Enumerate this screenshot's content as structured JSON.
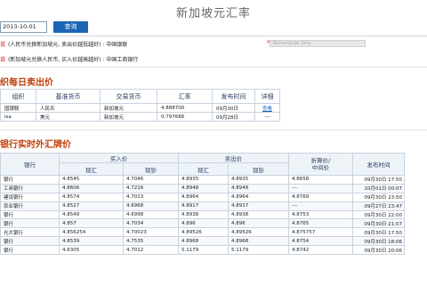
{
  "page": {
    "title": "新加坡元汇率"
  },
  "search": {
    "date": "2013-10-01",
    "button": "查询"
  },
  "notices": [
    {
      "tag": "说",
      "text": "(人民币兑换新加坡元, 卖出价越低越好) : 中国银联"
    },
    {
      "tag": "说",
      "text": "(新加坡元兑换人民币, 买入价越高越好) : 中国工商银行"
    }
  ],
  "ext_box": {
    "close": "×",
    "text": "Rectangular Snip"
  },
  "daily": {
    "title": "织每日卖出价",
    "headers": [
      "组织",
      "基准货币",
      "交易货币",
      "汇率",
      "发布时间",
      "详细"
    ],
    "rows": [
      {
        "org": "国银联",
        "base": "人民币",
        "target": "新加坡元",
        "rate": "4.888700",
        "time": "09月30日",
        "detail": "查看"
      },
      {
        "org": "isa",
        "base": "美元",
        "target": "新加坡元",
        "rate": "0.797686",
        "time": "09月28日",
        "detail": "---"
      }
    ]
  },
  "realtime": {
    "title": "银行实时外汇牌价",
    "headers": {
      "bank": "银行",
      "buy": "买入价",
      "sell": "卖出价",
      "mid": "折算价/\n中间价",
      "time": "发布时间",
      "sub": [
        "现汇",
        "现钞",
        "现汇",
        "现钞"
      ]
    },
    "rows": [
      [
        "银行",
        "4.8545",
        "4.7046",
        "4.8935",
        "4.8935",
        "4.8658",
        "09月30日 17:50"
      ],
      [
        "工商银行",
        "4.8606",
        "4.7216",
        "4.8948",
        "4.8948",
        "---",
        "10月01日 00:07"
      ],
      [
        "建设银行",
        "4.8574",
        "4.7013",
        "4.8964",
        "4.8964",
        "4.8769",
        "09月30日 23:50"
      ],
      [
        "农业银行",
        "4.8527",
        "4.6968",
        "4.8917",
        "4.8917",
        "---",
        "09月27日 23:47"
      ],
      [
        "银行",
        "4.8549",
        "4.6998",
        "4.8938",
        "4.8938",
        "4.8753",
        "09月30日 22:00"
      ],
      [
        "银行",
        "4.857",
        "4.7034",
        "4.896",
        "4.896",
        "4.8765",
        "09月30日 21:07"
      ],
      [
        "光大银行",
        "4.856254",
        "4.70023",
        "4.89526",
        "4.89526",
        "4.875757",
        "09月30日 17:50"
      ],
      [
        "银行",
        "4.8539",
        "4.7535",
        "4.8968",
        "4.8968",
        "4.8754",
        "09月30日 18:06"
      ],
      [
        "银行",
        "4.6305",
        "4.7012",
        "5.1179",
        "5.1179",
        "4.8742",
        "09月30日 20:06"
      ]
    ]
  }
}
